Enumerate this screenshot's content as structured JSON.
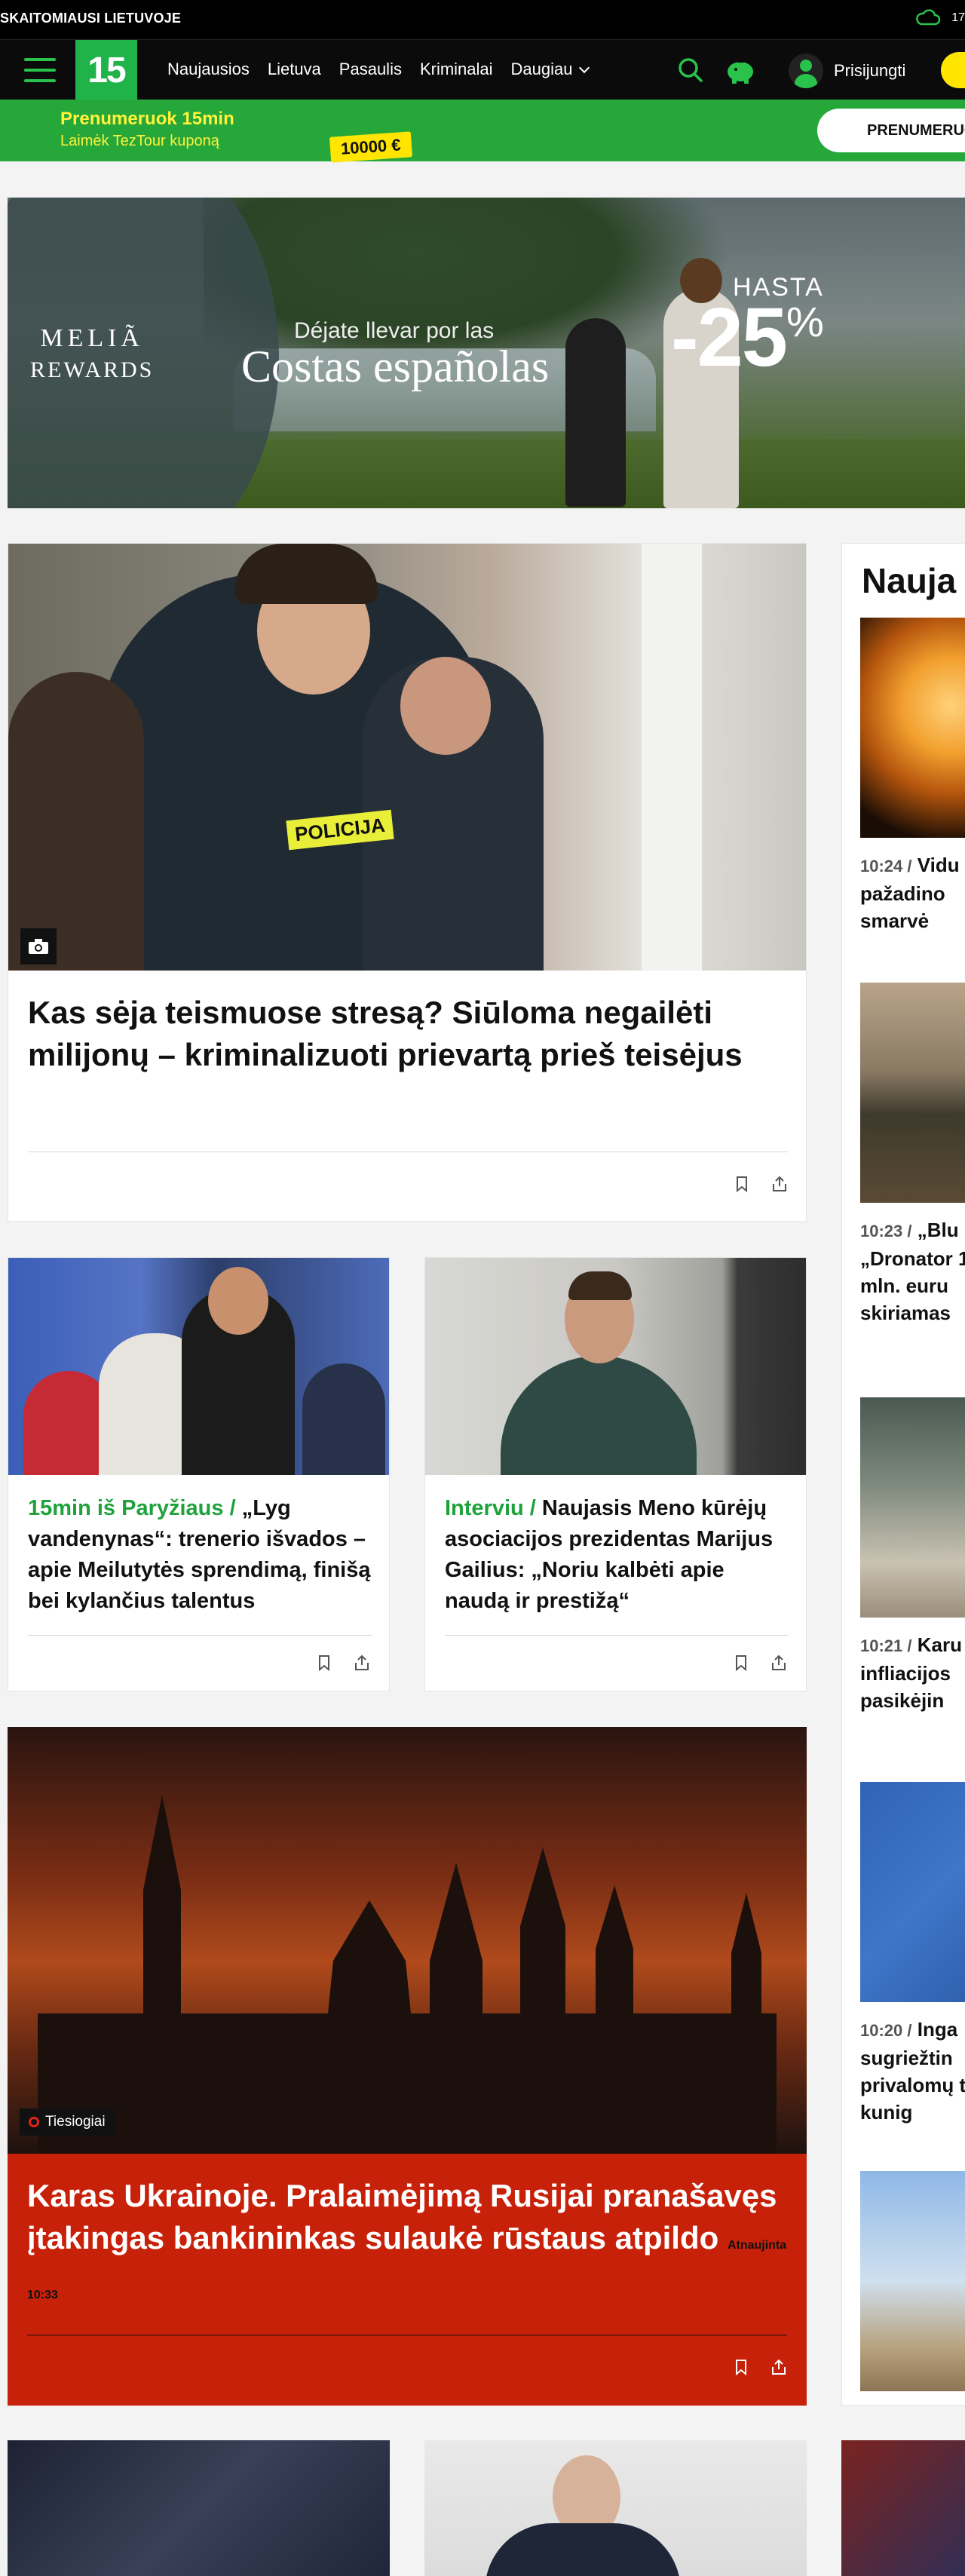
{
  "topbar": {
    "tagline": "SKAITOMIAUSI LIETUVOJE",
    "temperature": "17"
  },
  "nav": {
    "logo": "15",
    "items": [
      "Naujausios",
      "Lietuva",
      "Pasaulis",
      "Kriminalai",
      "Daugiau"
    ],
    "login": "Prisijungti"
  },
  "promo": {
    "title": "Prenumeruok 15min",
    "subtitle": "Laimėk TezTour kuponą",
    "coupon": "10000 €",
    "button": "PRENUMERUO"
  },
  "ad": {
    "brand_line1": "MELIÃ",
    "brand_line2": "REWARDS",
    "line1": "Déjate llevar por las",
    "line2": "Costas españolas",
    "hasta": "HASTA",
    "discount": "-25",
    "percent": "%"
  },
  "main_article": {
    "title": "Kas sėja teismuose stresą? Siūloma negailėti milijonų – kriminalizuoti prievartą prieš teisėjus",
    "vest_text": "POLICIJA"
  },
  "article_left": {
    "category": "15min iš Paryžiaus /",
    "title": "„Lyg vandenynas“: trenerio išvados – apie Meilutytės sprendimą, finišą bei kylančius talentus"
  },
  "article_right": {
    "category": "Interviu /",
    "title": "Naujasis Meno kūrėjų asociacijos prezidentas Marijus Gailius: „Noriu kalbėti apie naudą ir prestižą“"
  },
  "live_article": {
    "badge": "Tiesiogiai",
    "title": "Karas Ukrainoje. Pralaimėjimą Rusijai pranašavęs įtakingas bankininkas sulaukė rūstaus atpildo",
    "updated": "Atnaujinta 10:33"
  },
  "sidebar": {
    "heading": "Nauja",
    "items": [
      {
        "time": "10:24 /",
        "text": "Vidu pažadino smarvė"
      },
      {
        "time": "10:23 /",
        "text": "„Blu „Dronator 1 mln. euru skiriamas"
      },
      {
        "time": "10:21 /",
        "text": "Karu infliacijos pasikėjin"
      },
      {
        "time": "10:20 /",
        "text": "Inga sugriežtin privalomų tarp kunig"
      }
    ]
  },
  "colors": {
    "brand_green": "#1fb34a",
    "live_red": "#c8210a",
    "category_green": "#1fa23d"
  }
}
